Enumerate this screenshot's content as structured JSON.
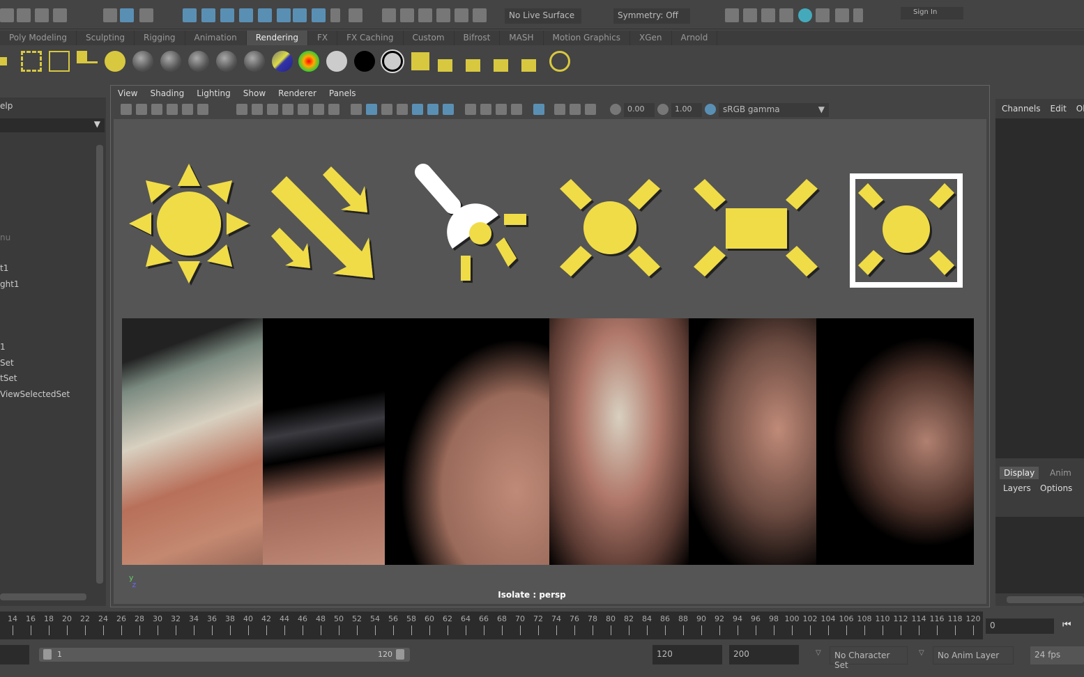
{
  "toolbar": {
    "live_surface": "No Live Surface",
    "symmetry": "Symmetry: Off",
    "sign_in": "Sign In"
  },
  "shelf_tabs": [
    "Poly Modeling",
    "Sculpting",
    "Rigging",
    "Animation",
    "Rendering",
    "FX",
    "FX Caching",
    "Custom",
    "Bifrost",
    "MASH",
    "Motion Graphics",
    "XGen",
    "Arnold"
  ],
  "active_shelf_tab": "Rendering",
  "outliner": {
    "menu": "elp",
    "items": [
      "nu",
      "t1",
      "ght1",
      "1",
      "Set",
      "tSet",
      "ViewSelectedSet"
    ]
  },
  "viewport": {
    "menu": [
      "View",
      "Shading",
      "Lighting",
      "Show",
      "Renderer",
      "Panels"
    ],
    "exposure": "0.00",
    "gamma": "1.00",
    "color_space": "sRGB gamma",
    "isolate_label": "Isolate : persp",
    "light_icons": [
      "ambient-light",
      "directional-light",
      "spot-light",
      "point-light",
      "area-light",
      "volume-light"
    ],
    "light_color": "#f0dc46"
  },
  "channel_box": {
    "tabs": [
      "Channels",
      "Edit",
      "Ob"
    ]
  },
  "layer_editor": {
    "tabs": [
      "Display",
      "Anim"
    ],
    "menu": [
      "Layers",
      "Options"
    ]
  },
  "timeline": {
    "labels": [
      "14",
      "16",
      "18",
      "20",
      "22",
      "24",
      "26",
      "28",
      "30",
      "32",
      "34",
      "36",
      "38",
      "40",
      "42",
      "44",
      "46",
      "48",
      "50",
      "52",
      "54",
      "56",
      "58",
      "60",
      "62",
      "64",
      "66",
      "68",
      "70",
      "72",
      "74",
      "76",
      "78",
      "80",
      "82",
      "84",
      "86",
      "88",
      "90",
      "92",
      "94",
      "96",
      "98",
      "100",
      "102",
      "104",
      "106",
      "108",
      "110",
      "112",
      "114",
      "116",
      "118",
      "120"
    ],
    "current_frame": "0"
  },
  "range": {
    "start": "1",
    "end": "120",
    "anim_end": "120",
    "max": "200",
    "character_set": "No Character Set",
    "anim_layer": "No Anim Layer",
    "fps": "24 fps"
  }
}
